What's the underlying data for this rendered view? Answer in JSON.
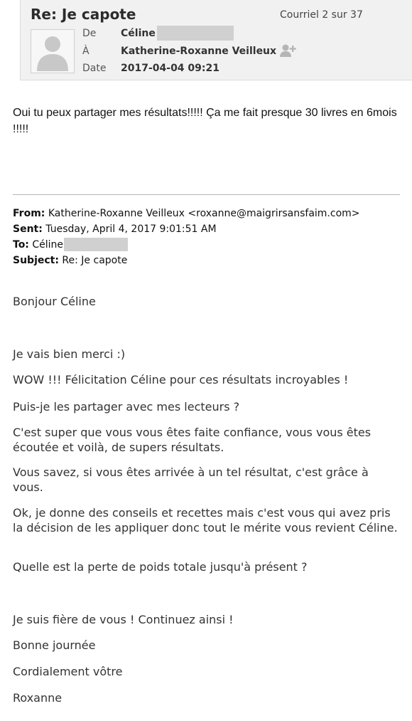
{
  "header": {
    "subject": "Re: Je capote",
    "counter": "Courriel 2 sur 37",
    "from_label": "De",
    "from_value": "Céline",
    "to_label": "À",
    "to_value": "Katherine-Roxanne Veilleux",
    "date_label": "Date",
    "date_value": "2017-04-04 09:21"
  },
  "reply": {
    "text": "Oui tu peux partager mes résultats!!!!! Ça me fait presque 30 livres en 6mois !!!!!"
  },
  "quoted_header": {
    "from_label": "From:",
    "from_value": "Katherine-Roxanne Veilleux <roxanne@maigrirsansfaim.com>",
    "sent_label": "Sent:",
    "sent_value": "Tuesday, April 4, 2017 9:01:51 AM",
    "to_label": "To:",
    "to_value": "Céline",
    "subject_label": "Subject:",
    "subject_value": "Re: Je capote"
  },
  "body": {
    "greeting": "Bonjour Céline",
    "p1": "Je vais bien merci :)",
    "p2": "WOW !!! Félicitation Céline pour ces résultats incroyables !",
    "p3": "Puis-je les partager avec mes lecteurs ?",
    "p4": "C'est super que vous vous êtes faite confiance, vous vous êtes écoutée et voilà, de supers résultats.",
    "p5": "Vous savez, si vous êtes arrivée à un tel résultat, c'est grâce à vous.",
    "p6": "Ok, je donne des conseils et recettes mais c'est vous qui avez pris la décision de les appliquer donc tout le mérite vous revient Céline.",
    "p7": "Quelle est la perte de poids totale jusqu'à présent ?",
    "p8": "Je suis fière de vous ! Continuez ainsi !",
    "p9": "Bonne journée",
    "p10": "Cordialement vôtre",
    "p11": "Roxanne"
  },
  "icons": {
    "avatar": "user-silhouette-icon",
    "add_contact": "add-contact-icon"
  }
}
